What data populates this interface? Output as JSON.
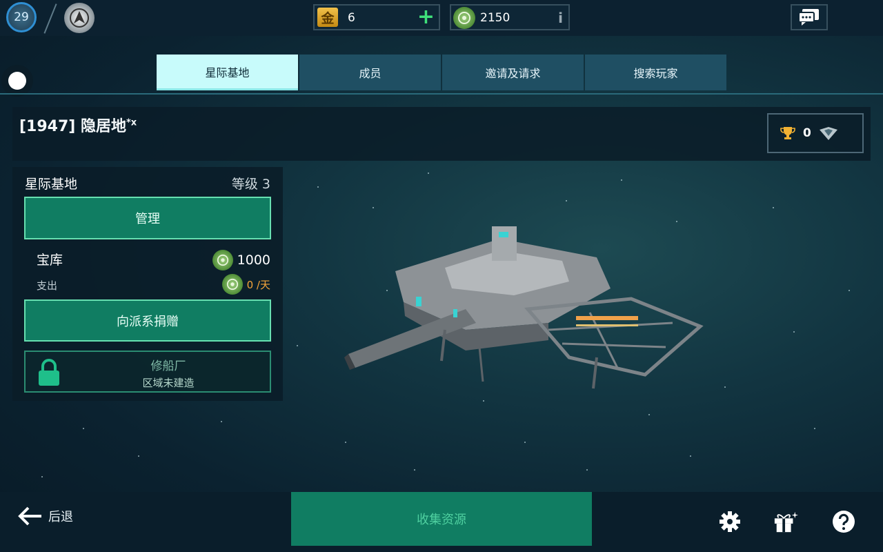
{
  "player": {
    "level": "29"
  },
  "currency": {
    "gold_symbol": "金",
    "gold": "6",
    "resource": "2150",
    "info": "i"
  },
  "tabs": [
    {
      "label": "星际基地"
    },
    {
      "label": "成员"
    },
    {
      "label": "邀请及请求"
    },
    {
      "label": "搜索玩家"
    }
  ],
  "base": {
    "title": "[1947] 隐居地",
    "suffix": "*x",
    "trophies": "0"
  },
  "panel": {
    "title": "星际基地",
    "level": "等级 3",
    "manage": "管理",
    "vault_label": "宝库",
    "vault_value": "1000",
    "expense_label": "支出",
    "expense_value": "0 /天",
    "donate": "向派系捐赠",
    "shipyard": "修船厂",
    "shipyard_status": "区域未建造"
  },
  "bottom": {
    "back": "后退",
    "collect": "收集资源"
  },
  "colors": {
    "accent": "#107d62",
    "tab_active": "#c8fbfb",
    "expense": "#f5a43a"
  }
}
